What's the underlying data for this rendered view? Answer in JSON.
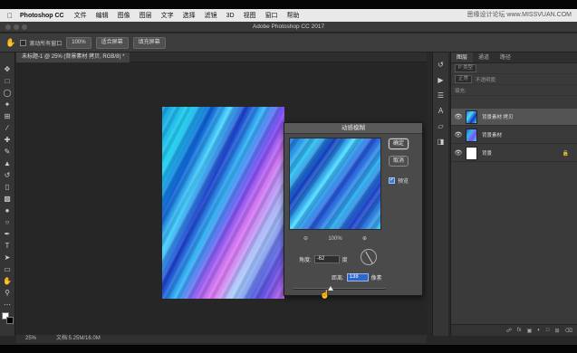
{
  "menubar": {
    "app": "Photoshop CC",
    "items": [
      "文件",
      "编辑",
      "图像",
      "图层",
      "文字",
      "选择",
      "滤镜",
      "3D",
      "视图",
      "窗口",
      "帮助"
    ],
    "watermark": "思缘设计论坛 www.MISSVUAN.COM"
  },
  "window": {
    "title": "Adobe Photoshop CC 2017"
  },
  "options": {
    "scroll_all_windows": "滚动所有窗口",
    "zoom": "100%",
    "fit_screen": "适合屏幕",
    "fill_screen": "填充屏幕"
  },
  "document": {
    "tab": "未标题-1 @ 25% (背景素材 拷贝, RGB/8) *",
    "zoom": "25%",
    "doc_size": "文档:5.25M/16.0M"
  },
  "dialog": {
    "title": "动感模糊",
    "ok": "确定",
    "cancel": "取消",
    "preview": "预览",
    "preview_checked": true,
    "zoom": "100%",
    "zoom_out": "⊖",
    "zoom_in": "⊕",
    "angle_label": "角度:",
    "angle_value": "-62",
    "angle_unit": "度",
    "distance_label": "距离:",
    "distance_value": "138",
    "distance_unit": "像素"
  },
  "layers_panel": {
    "tabs": [
      "图层",
      "通道",
      "路径"
    ],
    "kind": "P 类型",
    "blend": "正常",
    "opacity_label": "不透明度:",
    "fill_label": "填充:",
    "layers": [
      {
        "name": "背景素材 拷贝",
        "selected": true,
        "visible": true
      },
      {
        "name": "背景素材",
        "selected": false,
        "visible": true
      },
      {
        "name": "背景",
        "selected": false,
        "visible": true,
        "locked": true
      }
    ]
  },
  "colors": {
    "workspace": "#282828",
    "panel": "#3a3a3a",
    "accent": "#2b68c9"
  }
}
